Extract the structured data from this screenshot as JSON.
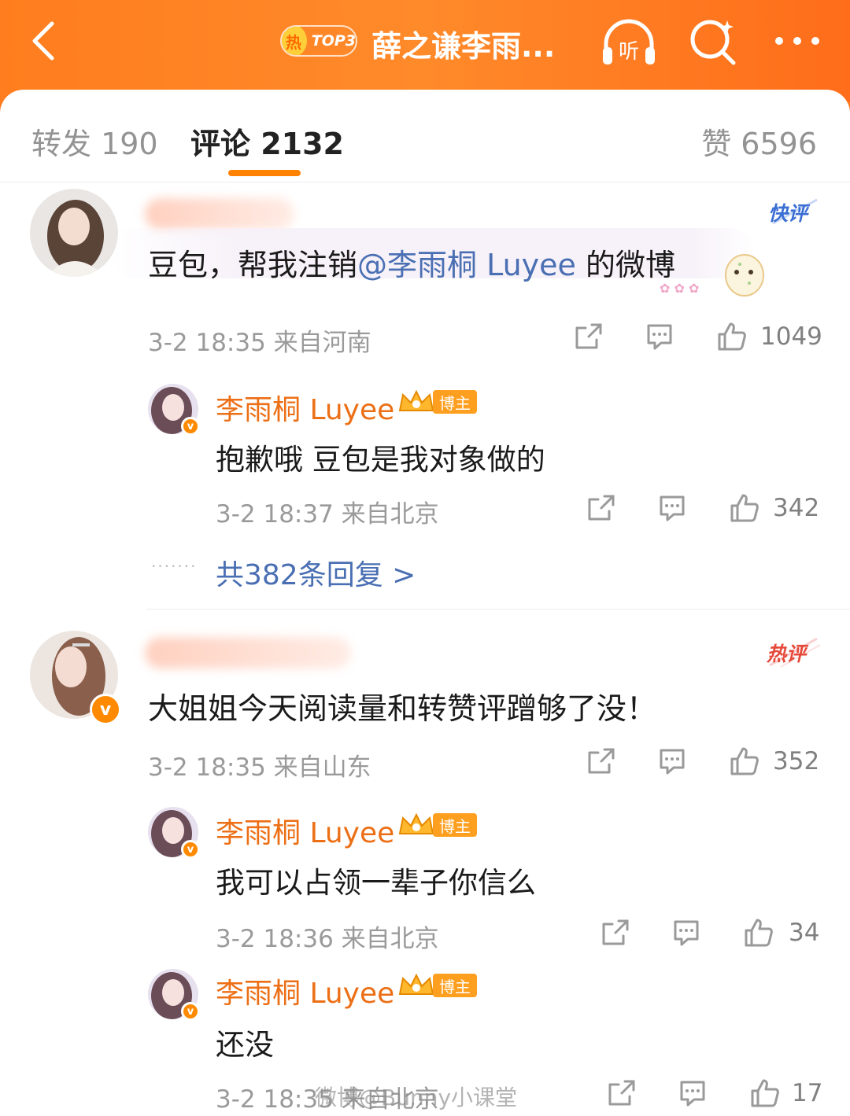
{
  "header": {
    "hot_char": "热",
    "hot_rank": "TOP3",
    "topic_title": "薛之谦李雨...",
    "listen_label": "听"
  },
  "tabs": {
    "repost": "转发 190",
    "comment": "评论 2132",
    "like": "赞 6596"
  },
  "comments": [
    {
      "tag": "快评",
      "text_before": "豆包，帮我注销",
      "mention": "@李雨桐 Luyee",
      "text_after": " 的微博",
      "meta": "3-2 18:35 来自河南",
      "likes": "1049",
      "replies": [
        {
          "name": "李雨桐 Luyee",
          "blogger_label": "博主",
          "text": "抱歉哦 豆包是我对象做的",
          "meta": "3-2 18:37 来自北京",
          "likes": "342"
        }
      ],
      "more_replies": "共382条回复 >"
    },
    {
      "tag": "热评",
      "text": "大姐姐今天阅读量和转赞评蹭够了没！",
      "meta": "3-2 18:35 来自山东",
      "likes": "352",
      "replies": [
        {
          "name": "李雨桐 Luyee",
          "blogger_label": "博主",
          "text": "我可以占领一辈子你信么",
          "meta": "3-2 18:36 来自北京",
          "likes": "34"
        },
        {
          "name": "李雨桐 Luyee",
          "blogger_label": "博主",
          "text": "还没",
          "meta": "3-2 18:35 来自北京",
          "likes": "17"
        }
      ]
    }
  ],
  "watermark": "微博@Bunny小课堂",
  "colors": {
    "brand_orange": "#ff8200",
    "link_blue": "#4a6fb3",
    "name_orange": "#ec6f16"
  }
}
